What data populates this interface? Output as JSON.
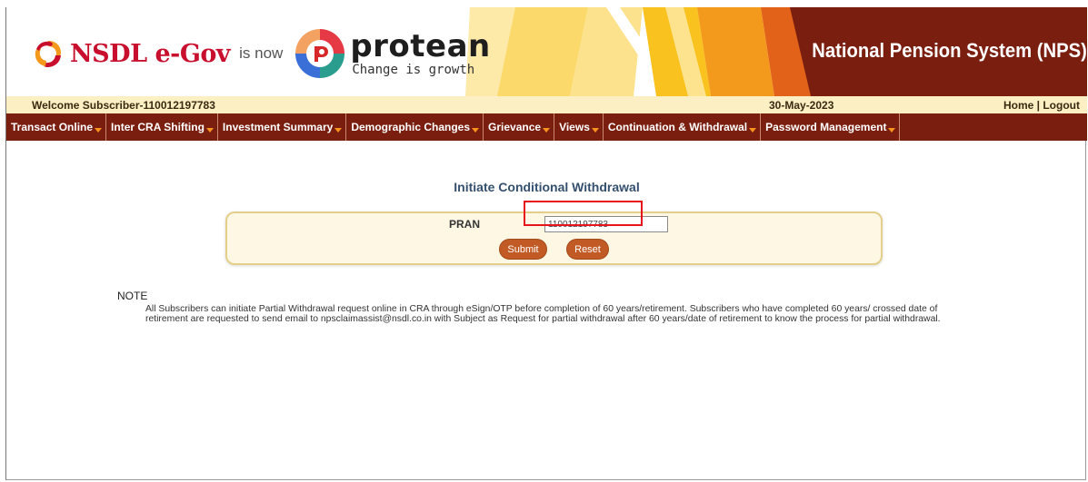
{
  "banner": {
    "nsdl_brand": "NSDL e-Gov",
    "is_now": "is now",
    "protean_brand": "protean",
    "protean_tagline": "Change is growth",
    "system_title": "National Pension System (NPS)"
  },
  "welcome_bar": {
    "welcome_text": "Welcome Subscriber-110012197783",
    "date": "30-May-2023",
    "home": "Home",
    "separator": " | ",
    "logout": "Logout"
  },
  "menu": {
    "items": [
      {
        "label": "Transact Online"
      },
      {
        "label": "Inter CRA Shifting"
      },
      {
        "label": "Investment Summary"
      },
      {
        "label": "Demographic Changes"
      },
      {
        "label": "Grievance"
      },
      {
        "label": "Views"
      },
      {
        "label": "Continuation & Withdrawal"
      },
      {
        "label": "Password Management"
      }
    ]
  },
  "form": {
    "title": "Initiate Conditional Withdrawal",
    "pran_label": "PRAN",
    "pran_value": "110012197783",
    "submit_label": "Submit",
    "reset_label": "Reset"
  },
  "note": {
    "heading": "NOTE",
    "text": "All Subscribers can initiate Partial Withdrawal request online in CRA through eSign/OTP before completion of 60 years/retirement. Subscribers who have completed 60 years/ crossed date of retirement are requested to send email to npsclaimassist@nsdl.co.in with Subject as Request for partial withdrawal after 60 years/date of retirement to know the process for partial withdrawal."
  },
  "colors": {
    "menu_bg": "#7a1f10",
    "welcome_bg": "#fcefc4",
    "button_bg": "#c25a25",
    "highlight_border": "#e8141b"
  }
}
